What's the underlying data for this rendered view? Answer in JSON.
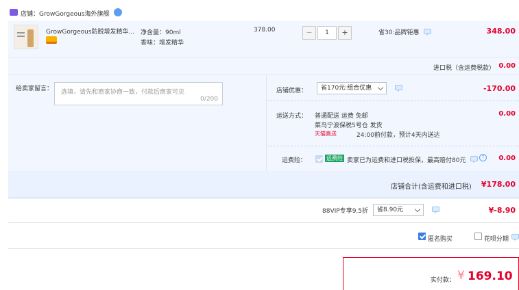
{
  "shop": {
    "label": "店铺：",
    "name": "GrowGorgeous海外旗舰"
  },
  "item": {
    "title": "GrowGorgeous防脱增发精华...",
    "spec_volume": "净含量：90ml",
    "spec_scent": "香味：增发精华",
    "unit_price": "378.00",
    "quantity": "1",
    "discount_note": "省30:品牌钜惠",
    "subtotal": "348.00",
    "minus": "−",
    "plus": "+"
  },
  "import_tax": {
    "label": "进口税（含运费税款）",
    "value": "0.00"
  },
  "message": {
    "label": "给卖家留言：",
    "placeholder": "选填，请先和商家协商一致，付款后商家可见",
    "counter": "0/200"
  },
  "shop_discount": {
    "label": "店铺优惠：",
    "selected": "省170元:组合优惠",
    "value": "-170.00"
  },
  "shipping": {
    "label": "运送方式：",
    "method": "普通配送 运费 免邮",
    "origin": "菜鸟宁波保税5号仓  发货",
    "badge": "天猫直送",
    "promise": "24:00前付款，预计4天内送达",
    "value": "0.00"
  },
  "insurance": {
    "label": "运费险：",
    "tag": "运费险",
    "text": "卖家已为运费和进口税投保，最高赔付80元",
    "value": "0.00"
  },
  "shop_total": {
    "label": "店铺合计(含运费和进口税)",
    "value": "¥178.00"
  },
  "vip": {
    "label": "88VIP专享9.5折",
    "selected": "省8.90元",
    "value": "¥-8.90"
  },
  "options": {
    "anonymous": "匿名购买",
    "installment": "花呗分期"
  },
  "payment": {
    "label": "实付款：",
    "currency": "¥",
    "amount": "169.10"
  },
  "colors": {
    "accent": "#e4002b",
    "blue_bg": "#f2f7ff",
    "checkbox": "#3a7fe0"
  }
}
